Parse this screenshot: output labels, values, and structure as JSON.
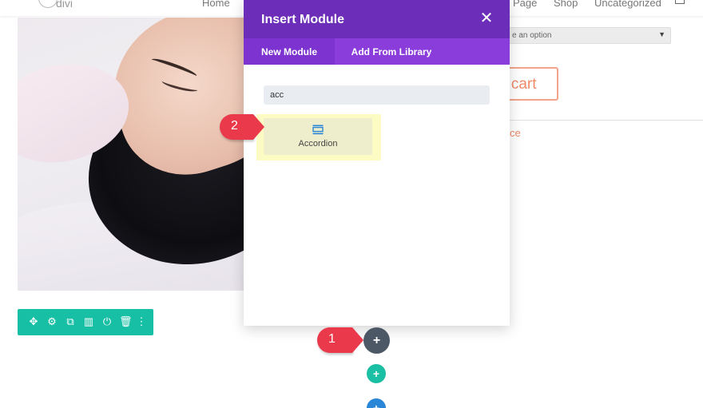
{
  "nav": {
    "logo_text": "divi",
    "items": [
      "Home",
      "Page",
      "Shop",
      "Uncategorized"
    ],
    "cart_icon": "cart-icon"
  },
  "product": {
    "variation_select_value": "e an option",
    "add_to_cart_label": "o cart",
    "link_fragment": "ce"
  },
  "modal": {
    "title": "Insert Module",
    "close_icon": "close-icon",
    "tabs": [
      {
        "label": "New Module",
        "active": true
      },
      {
        "label": "Add From Library",
        "active": false
      }
    ],
    "search_value": "acc",
    "results": [
      {
        "label": "Accordion",
        "icon": "accordion-icon"
      }
    ]
  },
  "toolbar": {
    "icons": [
      "move-icon",
      "gear-icon",
      "duplicate-icon",
      "columns-icon",
      "power-icon",
      "trash-icon",
      "more-icon"
    ]
  },
  "callouts": {
    "one": "1",
    "two": "2"
  },
  "add_buttons": {
    "symbol": "+"
  },
  "colors": {
    "modal_header": "#6c2eb9",
    "modal_tabs": "#8a3ddb",
    "toolbar": "#17bfa4",
    "callout": "#e9394a",
    "accent_orange": "#f08a68",
    "add_dark": "#4c5866",
    "add_teal": "#1abfa4",
    "add_blue": "#2a86d6"
  }
}
